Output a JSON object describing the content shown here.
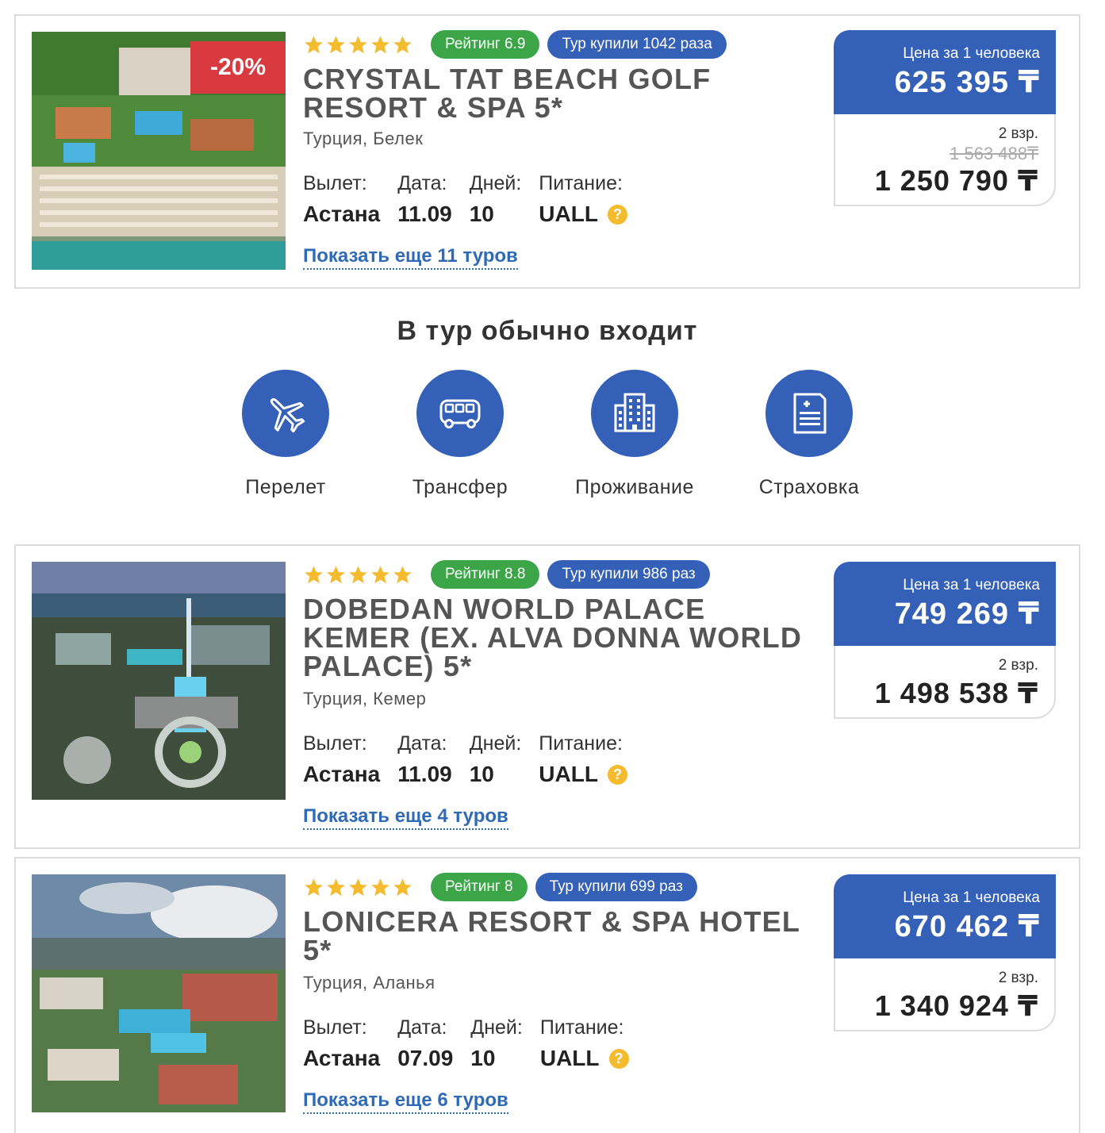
{
  "colors": {
    "accent_blue": "#3461b7",
    "rating_green": "#3ba548",
    "discount_red": "#d93a3f",
    "star_gold": "#f3bb2d",
    "link_blue": "#2f6ab7"
  },
  "labels": {
    "departure": "Вылет:",
    "date": "Дата:",
    "days": "Дней:",
    "meals": "Питание:",
    "price_per_person": "Цена за 1 человека",
    "help_glyph": "?"
  },
  "hotels": [
    {
      "stars": 5,
      "discount": "-20%",
      "rating": "Рейтинг 6.9",
      "bought": "Тур купили 1042 раза",
      "name": "CRYSTAL TAT BEACH GOLF RESORT & SPA 5*",
      "location": "Турция, Белек",
      "departure": "Астана",
      "date": "11.09",
      "days": "10",
      "meals": "UALL",
      "price_per_person": "625 395 ₸",
      "people": "2 взр.",
      "old_price": "1 563 488₸",
      "total_price": "1 250 790 ₸",
      "more_link": "Показать еще 11 туров"
    },
    {
      "stars": 5,
      "rating": "Рейтинг 8.8",
      "bought": "Тур купили 986 раз",
      "name": "DOBEDAN WORLD PALACE KEMER (EX. ALVA DONNA WORLD PALACE) 5*",
      "location": "Турция, Кемер",
      "departure": "Астана",
      "date": "11.09",
      "days": "10",
      "meals": "UALL",
      "price_per_person": "749 269 ₸",
      "people": "2 взр.",
      "total_price": "1 498 538 ₸",
      "more_link": "Показать еще 4 туров"
    },
    {
      "stars": 5,
      "rating": "Рейтинг 8",
      "bought": "Тур купили 699 раз",
      "name": "LONICERA RESORT & SPA HOTEL 5*",
      "location": "Турция, Аланья",
      "departure": "Астана",
      "date": "07.09",
      "days": "10",
      "meals": "UALL",
      "price_per_person": "670 462 ₸",
      "people": "2 взр.",
      "total_price": "1 340 924 ₸",
      "more_link": "Показать еще 6 туров"
    }
  ],
  "includes": {
    "title": "В тур обычно входит",
    "items": [
      {
        "label": "Перелет",
        "icon": "airplane-icon"
      },
      {
        "label": "Трансфер",
        "icon": "bus-icon"
      },
      {
        "label": "Проживание",
        "icon": "building-icon"
      },
      {
        "label": "Страховка",
        "icon": "insurance-document-icon"
      }
    ]
  }
}
